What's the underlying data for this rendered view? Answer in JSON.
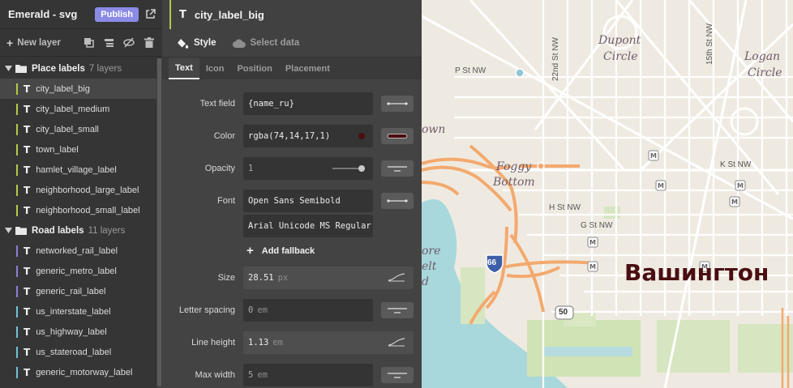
{
  "app": {
    "title": "Emerald - svg",
    "publish_label": "Publish",
    "new_layer_label": "New layer"
  },
  "groups": [
    {
      "name": "Place labels",
      "count": "7 layers",
      "layers": [
        {
          "name": "city_label_big",
          "color": "#b5c94a",
          "selected": true
        },
        {
          "name": "city_label_medium",
          "color": "#b5c94a"
        },
        {
          "name": "city_label_small",
          "color": "#b5c94a"
        },
        {
          "name": "town_label",
          "color": "#b5c94a"
        },
        {
          "name": "hamlet_village_label",
          "color": "#b5c94a"
        },
        {
          "name": "neighborhood_large_label",
          "color": "#b5c94a"
        },
        {
          "name": "neighborhood_small_label",
          "color": "#b5c94a"
        }
      ]
    },
    {
      "name": "Road labels",
      "count": "11 layers",
      "layers": [
        {
          "name": "networked_rail_label",
          "color": "#8a7fd6"
        },
        {
          "name": "generic_metro_label",
          "color": "#8a7fd6"
        },
        {
          "name": "generic_rail_label",
          "color": "#8a7fd6"
        },
        {
          "name": "us_interstate_label",
          "color": "#6fc3d6"
        },
        {
          "name": "us_highway_label",
          "color": "#6fc3d6"
        },
        {
          "name": "us_stateroad_label",
          "color": "#6fc3d6"
        },
        {
          "name": "generic_motorway_label",
          "color": "#6fc3d6"
        }
      ]
    }
  ],
  "panel": {
    "layer_name": "city_label_big",
    "main_tabs": [
      "Style",
      "Select data"
    ],
    "sub_tabs": [
      "Text",
      "Icon",
      "Position",
      "Placement"
    ],
    "properties": {
      "text_field": {
        "label": "Text field",
        "value": "{name_ru}"
      },
      "color": {
        "label": "Color",
        "value": "rgba(74,14,17,1)",
        "swatch": "#4a0e11"
      },
      "opacity": {
        "label": "Opacity",
        "value": "1",
        "level": 1
      },
      "font": {
        "label": "Font",
        "value": "Open Sans Semibold",
        "fallback": "Arial Unicode MS Regular"
      },
      "add_fallback": "Add fallback",
      "size": {
        "label": "Size",
        "value": "28.51",
        "unit": "px"
      },
      "letter_spacing": {
        "label": "Letter spacing",
        "value": "0",
        "unit": "em"
      },
      "line_height": {
        "label": "Line height",
        "value": "1.13",
        "unit": "em"
      },
      "max_width": {
        "label": "Max width",
        "value": "5",
        "unit": "em"
      }
    }
  },
  "map": {
    "city_label": "Вашингтон",
    "neighborhoods": [
      "Dupont",
      "Circle",
      "Logan",
      "Circle",
      "Foggy",
      "Bottom",
      "own",
      "ore",
      "elt",
      "d"
    ],
    "streets": [
      "P St NW",
      "22nd St NW",
      "15th St NW",
      "K St NW",
      "H St NW",
      "G St NW"
    ],
    "shields": [
      "66",
      "50"
    ],
    "colors": {
      "land": "#efeae1",
      "water": "#a8d8dc",
      "park": "#cfe3b4",
      "highway": "#f3a96e",
      "label": "#4a0e11"
    }
  }
}
